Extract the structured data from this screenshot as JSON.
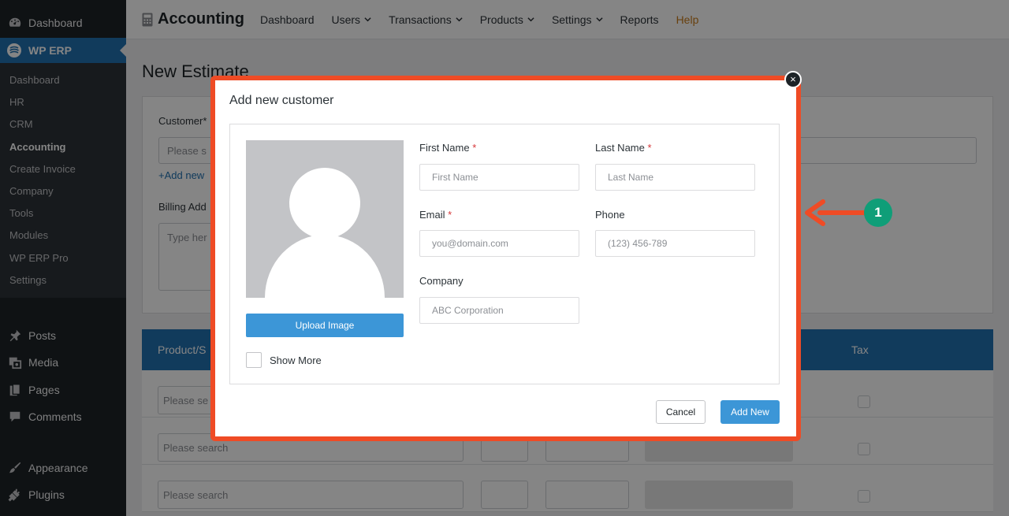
{
  "sidebar": {
    "top": "Dashboard",
    "active": "WP ERP",
    "submenu": [
      "Dashboard",
      "HR",
      "CRM",
      "Accounting",
      "Create Invoice",
      "Company",
      "Tools",
      "Modules",
      "WP ERP Pro",
      "Settings"
    ],
    "main": [
      "Posts",
      "Media",
      "Pages",
      "Comments",
      "Appearance",
      "Plugins"
    ]
  },
  "topnav": {
    "brand": "Accounting",
    "items": [
      "Dashboard",
      "Users",
      "Transactions",
      "Products",
      "Settings",
      "Reports",
      "Help"
    ]
  },
  "page": {
    "title": "New Estimate",
    "customer_label": "Customer*",
    "customer_placeholder": "Please s",
    "add_new_link": "+Add new",
    "billing_label": "Billing Add",
    "billing_placeholder": "Type her",
    "table": {
      "col_product": "Product/S",
      "col_tax": "Tax",
      "row_placeholder_short": "Please se",
      "row_placeholder": "Please search"
    }
  },
  "modal": {
    "title": "Add new customer",
    "close": "×",
    "upload_button": "Upload Image",
    "show_more": "Show More",
    "fields": {
      "first_name": {
        "label": "First Name",
        "required": "*",
        "placeholder": "First Name"
      },
      "last_name": {
        "label": "Last Name",
        "required": "*",
        "placeholder": "Last Name"
      },
      "email": {
        "label": "Email",
        "required": "*",
        "placeholder": "you@domain.com"
      },
      "phone": {
        "label": "Phone",
        "placeholder": "(123) 456-789"
      },
      "company": {
        "label": "Company",
        "placeholder": "ABC Corporation"
      }
    },
    "cancel_button": "Cancel",
    "add_button": "Add New"
  },
  "annotation": {
    "badge": "1"
  },
  "colors": {
    "wp_blue": "#2271b1",
    "sidebar": "#1d2327",
    "highlight_outline": "#ef4b25",
    "badge": "#0f9e78",
    "primary_button": "#3c96d7"
  }
}
